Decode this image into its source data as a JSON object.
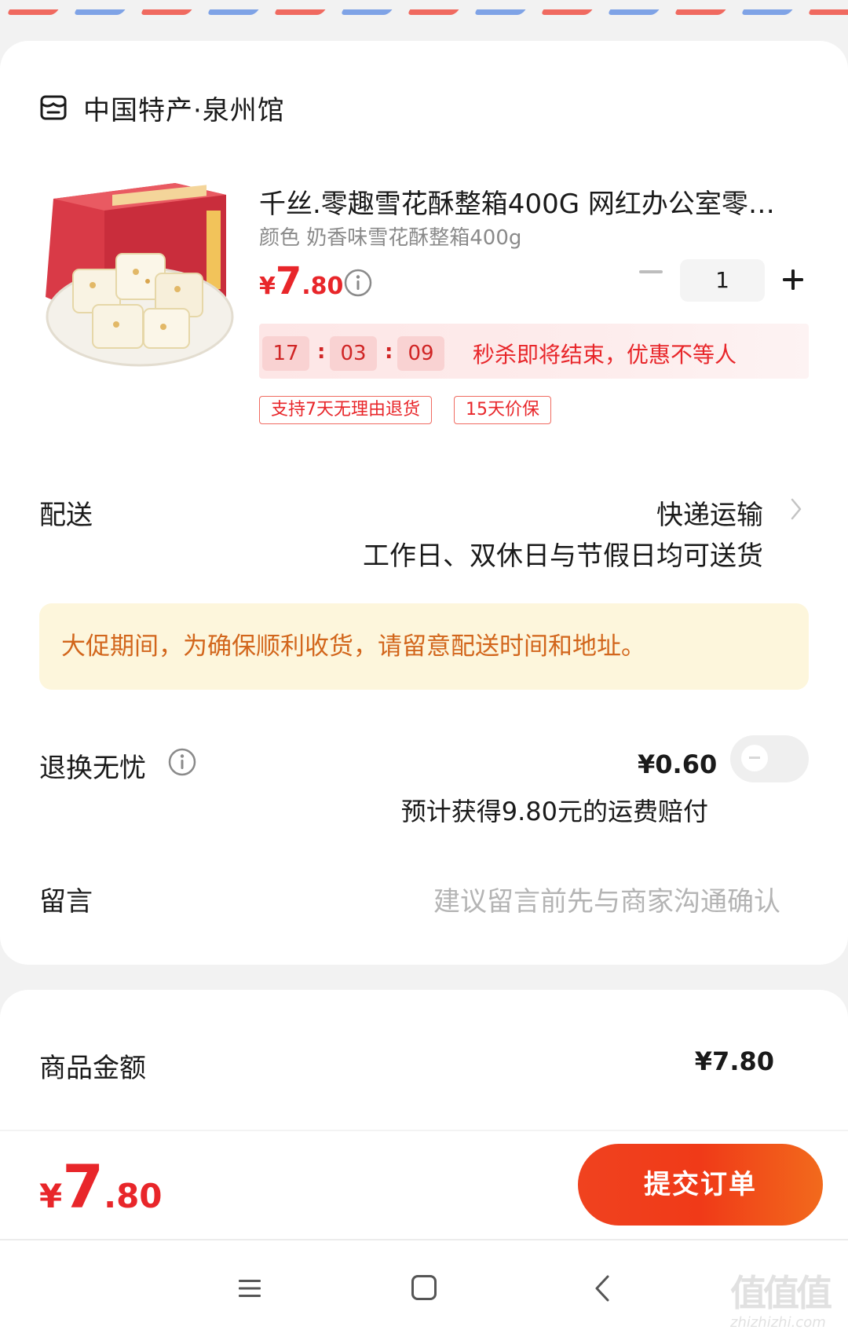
{
  "shop": {
    "name": "中国特产·泉州馆",
    "icon": "store-icon"
  },
  "product": {
    "title": "千丝.零趣雪花酥整箱400G 网红办公室零…",
    "sku": "颜色 奶香味雪花酥整箱400g",
    "price_currency": "¥",
    "price_int": "7",
    "price_dec": ".80",
    "quantity": "1",
    "countdown": {
      "hours": "17",
      "minutes": "03",
      "seconds": "09",
      "separator": ":"
    },
    "flash_text": "秒杀即将结束，优惠不等人",
    "tags": [
      "支持7天无理由退货",
      "15天价保"
    ]
  },
  "delivery": {
    "label": "配送",
    "method": "快递运输",
    "schedule": "工作日、双休日与节假日均可送货"
  },
  "notice": {
    "text": "大促期间，为确保顺利收货，请留意配送时间和地址。"
  },
  "returns": {
    "label": "退换无忧",
    "price": "¥0.60",
    "subtext": "预计获得9.80元的运费赔付",
    "toggle_on": false
  },
  "message": {
    "label": "留言",
    "placeholder": "建议留言前先与商家沟通确认"
  },
  "summary": {
    "amount_label": "商品金额",
    "amount_value": "¥7.80"
  },
  "footer": {
    "total_currency": "¥",
    "total_int": "7",
    "total_dec": ".80",
    "submit_label": "提交订单"
  },
  "watermark": {
    "glyphs": "值值值",
    "url": "zhizhizhi.com"
  },
  "colors": {
    "accent_red": "#e8262a",
    "notice_bg": "#fdf6dc",
    "notice_text": "#d2661c",
    "button_start": "#f0421f",
    "button_end": "#f26a1c"
  }
}
